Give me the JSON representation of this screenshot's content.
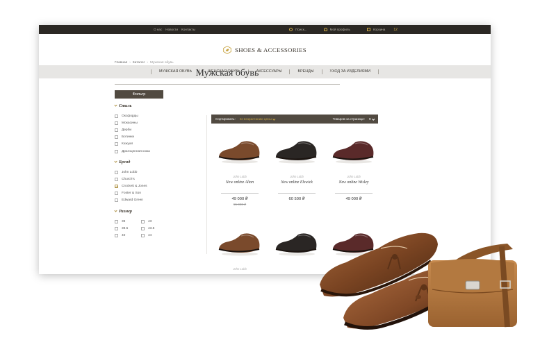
{
  "topbar": {
    "links": [
      "О нас",
      "Новости",
      "Контакты"
    ],
    "search_placeholder": "Поиск...",
    "profile_label": "Мой профиль",
    "cart_label": "Корзина",
    "cart_count": "12"
  },
  "header": {
    "logo_text": "SHOES & ACCESSORIES"
  },
  "nav": {
    "items": [
      "МУЖСКАЯ ОБУВЬ",
      "ЖЕНСКАЯ ОБУВЬ",
      "АКСЕССУАРЫ",
      "БРЕНДЫ",
      "УХОД ЗА ИЗДЕЛИЯМИ"
    ]
  },
  "breadcrumb": {
    "items": [
      "Главная",
      "Каталог",
      "Мужская обувь"
    ],
    "separator": "›"
  },
  "page": {
    "title": "Мужская обувь"
  },
  "sidebar": {
    "filter_label": "Фильтр",
    "style": {
      "title": "Стиль",
      "options": [
        "Оксфорды",
        "Мокасины",
        "Дерби",
        "Ботинки",
        "Кэжуал",
        "Драгоценная кожа"
      ]
    },
    "brand": {
      "title": "Бренд",
      "options": [
        {
          "label": "John Lobb",
          "checked": false
        },
        {
          "label": "Church's",
          "checked": false
        },
        {
          "label": "Crockett & Jones",
          "checked": true
        },
        {
          "label": "Foster & Son",
          "checked": false
        },
        {
          "label": "Edward Green",
          "checked": false
        }
      ]
    },
    "size": {
      "title": "Размер",
      "options": [
        "39",
        "43",
        "39.5",
        "43.5",
        "40",
        "44"
      ]
    }
  },
  "sortbar": {
    "sort_label": "Сортировать:",
    "sort_value": "по возрастанию цены",
    "per_page_label": "Товаров на странице:",
    "per_page_value": "9"
  },
  "products": [
    {
      "brand": "John Lobb",
      "name": "New online Alton",
      "price": "49 000 ₽",
      "old_price": "55 000 ₽",
      "color": "#7a4a2c"
    },
    {
      "brand": "John Lobb",
      "name": "New online Elswick",
      "price": "60 500 ₽",
      "old_price": "",
      "color": "#2a2624"
    },
    {
      "brand": "John Lobb",
      "name": "New online Wisley",
      "price": "49 000 ₽",
      "old_price": "",
      "color": "#5a2a2a"
    },
    {
      "brand": "John Lobb",
      "name": "",
      "price": "",
      "old_price": "",
      "color": "#7a4a2c"
    },
    {
      "brand": "",
      "name": "",
      "price": "",
      "old_price": "",
      "color": "#2a2624"
    },
    {
      "brand": "",
      "name": "",
      "price": "",
      "old_price": "",
      "color": "#5a2a2a"
    }
  ],
  "colors": {
    "dark": "#2b2824",
    "accent": "#c9a544",
    "bar": "#514a41",
    "nav_bg": "#e7e6e4"
  }
}
